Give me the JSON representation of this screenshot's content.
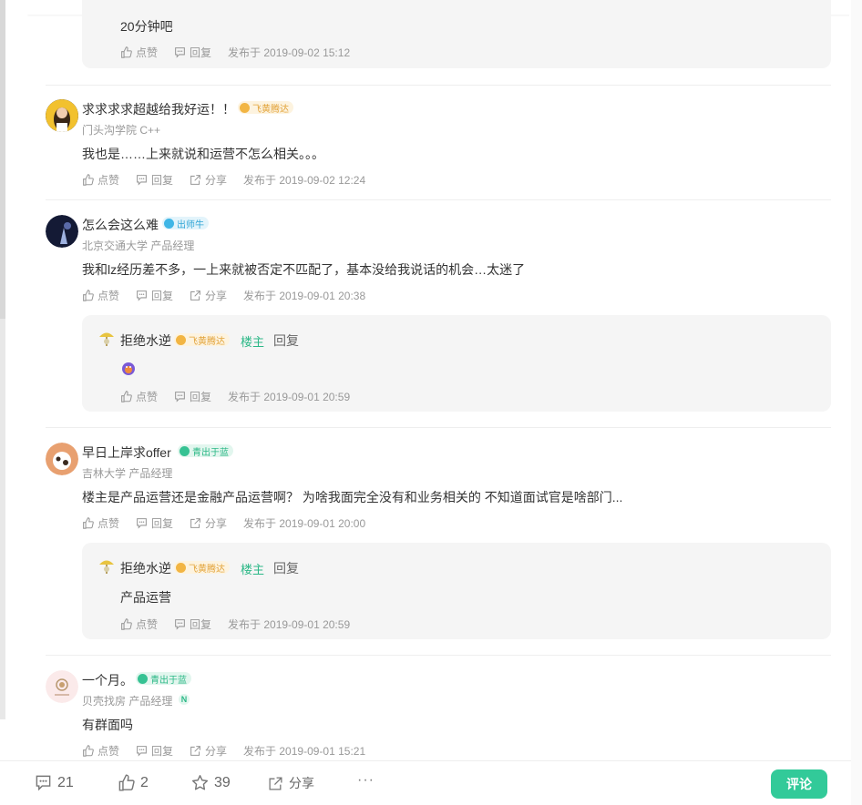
{
  "icons": {
    "like": "thumb-up-icon",
    "reply": "comment-bubble-icon",
    "share": "share-icon",
    "star": "star-icon",
    "more": "more-dots-icon"
  },
  "colors": {
    "accent": "#32ca99",
    "owner_tag": "#2cb887",
    "muted": "#999999",
    "reply_bg": "#f5f5f5"
  },
  "top_reply": {
    "content": "20分钟吧",
    "like_label": "点赞",
    "reply_label": "回复",
    "time": "发布于 2019-09-02 15:12"
  },
  "comments": [
    {
      "name": "求求求求超越给我好运！！",
      "badge": "飞黄腾达",
      "school": "门头沟学院 C++",
      "content": "我也是……上来就说和运营不怎么相关。。。",
      "like_label": "点赞",
      "reply_label": "回复",
      "share_label": "分享",
      "time": "发布于 2019-09-02 12:24"
    },
    {
      "name": "怎么会这么难",
      "badge": "出师牛",
      "school": "北京交通大学 产品经理",
      "content": "我和lz经历差不多，一上来就被否定不匹配了，基本没给我说话的机会…太迷了",
      "like_label": "点赞",
      "reply_label": "回复",
      "share_label": "分享",
      "time": "发布于 2019-09-01 20:38",
      "reply": {
        "name": "拒绝水逆",
        "badge": "飞黄腾达",
        "owner_tag": "楼主",
        "reply_action": "回复",
        "content": "",
        "like_label": "点赞",
        "reply_label": "回复",
        "time": "发布于 2019-09-01 20:59"
      }
    },
    {
      "name": "早日上岸求offer",
      "badge": "青出于蓝",
      "school": "吉林大学 产品经理",
      "content": "楼主是产品运营还是金融产品运营啊？ 为啥我面完全没有和业务相关的 不知道面试官是啥部门...",
      "like_label": "点赞",
      "reply_label": "回复",
      "share_label": "分享",
      "time": "发布于 2019-09-01 20:00",
      "reply": {
        "name": "拒绝水逆",
        "badge": "飞黄腾达",
        "owner_tag": "楼主",
        "reply_action": "回复",
        "content": "产品运营",
        "like_label": "点赞",
        "reply_label": "回复",
        "time": "发布于 2019-09-01 20:59"
      }
    },
    {
      "name": "一个月。",
      "badge": "青出于蓝",
      "school": "贝壳找房 产品经理",
      "school_tag": "N",
      "content": "有群面吗",
      "like_label": "点赞",
      "reply_label": "回复",
      "share_label": "分享",
      "time": "发布于 2019-09-01 15:21"
    }
  ],
  "bottom_bar": {
    "comments_count": "21",
    "likes_count": "2",
    "stars_count": "39",
    "share_label": "分享",
    "more_label": "···",
    "comment_button": "评论"
  }
}
